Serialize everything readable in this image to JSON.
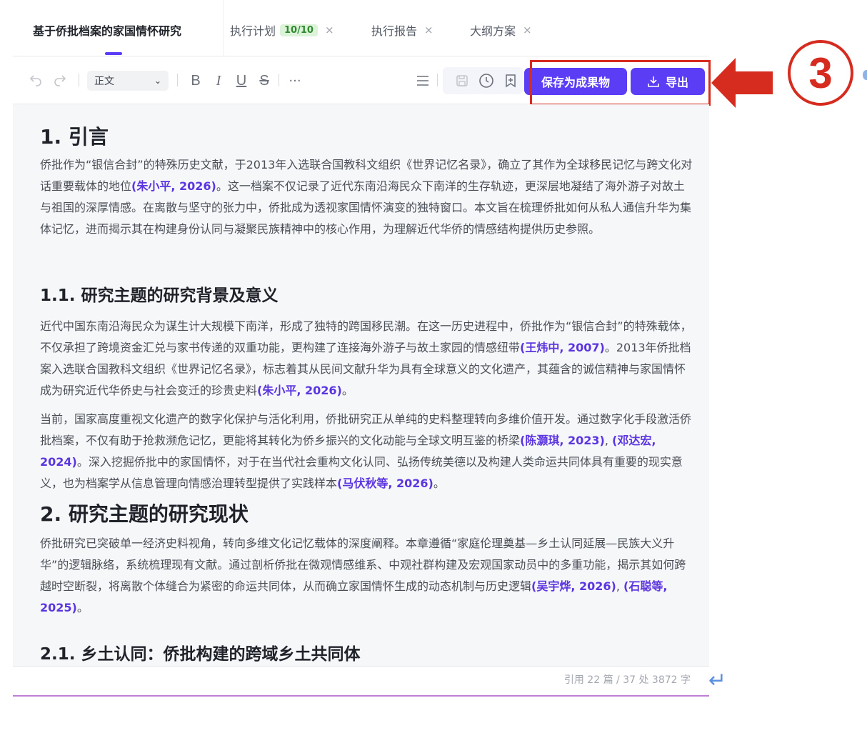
{
  "tabs": [
    {
      "label": "基于侨批档案的家国情怀研究",
      "active": true
    },
    {
      "label": "执行计划",
      "badge": "10/10",
      "close": "×"
    },
    {
      "label": "执行报告",
      "close": "×"
    },
    {
      "label": "大纲方案",
      "close": "×"
    }
  ],
  "toolbar": {
    "undo_icon": "undo-icon",
    "redo_icon": "redo-icon",
    "style_select": "正文",
    "bold": "B",
    "italic": "I",
    "underline": "U",
    "strike": "S",
    "more": "···",
    "save_as_artifact": "保存为成果物",
    "export": "导出"
  },
  "annotation": {
    "step": "3",
    "color": "#d62c1f"
  },
  "colors": {
    "accent": "#5b3df5",
    "citation": "#5b35e0"
  },
  "doc": {
    "h1_1": "1. 引言",
    "p1": [
      "侨批作为“银信合封”的特殊历史文献，于2013年入选联合国教科文组织《世界记忆名录》，确立了其作为全球移民记忆与跨文化对话重要载体的地位",
      "(朱小平, 2026)",
      "。这一档案不仅记录了近代东南沿海民众下南洋的生存轨迹，更深层地凝结了海外游子对故土与祖国的深厚情感。在离散与坚守的张力中，侨批成为透视家国情怀演变的独特窗口。本文旨在梳理侨批如何从私人通信升华为集体记忆，进而揭示其在构建身份认同与凝聚民族精神中的核心作用，为理解近代华侨的情感结构提供历史参照。"
    ],
    "h2_1": "1.1. 研究主题的研究背景及意义",
    "p2": [
      "近代中国东南沿海民众为谋生计大规模下南洋，形成了独特的跨国移民潮。在这一历史进程中，侨批作为“银信合封”的特殊载体，不仅承担了跨境资金汇兑与家书传递的双重功能，更构建了连接海外游子与故土家园的情感纽带",
      "(王炜中, 2007)",
      "。2013年侨批档案入选联合国教科文组织《世界记忆名录》，标志着其从民间文献升华为具有全球意义的文化遗产，其蕴含的诚信精神与家国情怀成为研究近代华侨史与社会变迁的珍贵史料",
      "(朱小平, 2026)",
      "。"
    ],
    "p3": [
      "当前，国家高度重视文化遗产的数字化保护与活化利用，侨批研究正从单纯的史料整理转向多维价值开发。通过数字化手段激活侨批档案，不仅有助于抢救濒危记忆，更能将其转化为侨乡振兴的文化动能与全球文明互鉴的桥梁",
      "(陈灏琪, 2023)",
      ", ",
      "(邓达宏, 2024)",
      "。深入挖掘侨批中的家国情怀，对于在当代社会重构文化认同、弘扬传统美德以及构建人类命运共同体具有重要的现实意义，也为档案学从信息管理向情感治理转型提供了实践样本",
      "(马伏秋等, 2026)",
      "。"
    ],
    "h1_2": "2. 研究主题的研究现状",
    "p4": [
      "侨批研究已突破单一经济史料视角，转向多维文化记忆载体的深度阐释。本章遵循“家庭伦理奠基—乡土认同延展—民族大义升华”的逻辑脉络，系统梳理现有文献。通过剖析侨批在微观情感维系、中观社群构建及宏观国家动员中的多重功能，揭示其如何跨越时空断裂，将离散个体缝合为紧密的命运共同体，从而确立家国情怀生成的动态机制与历史逻辑",
      "(吴宇烨, 2026)",
      ", ",
      "(石聪等, 2025)",
      "。"
    ],
    "h2_2": "2.1. 乡土认同：侨批构建的跨域乡土共同体"
  },
  "footer": {
    "stats": "引用 22 篇 / 37 处   3872 字"
  }
}
